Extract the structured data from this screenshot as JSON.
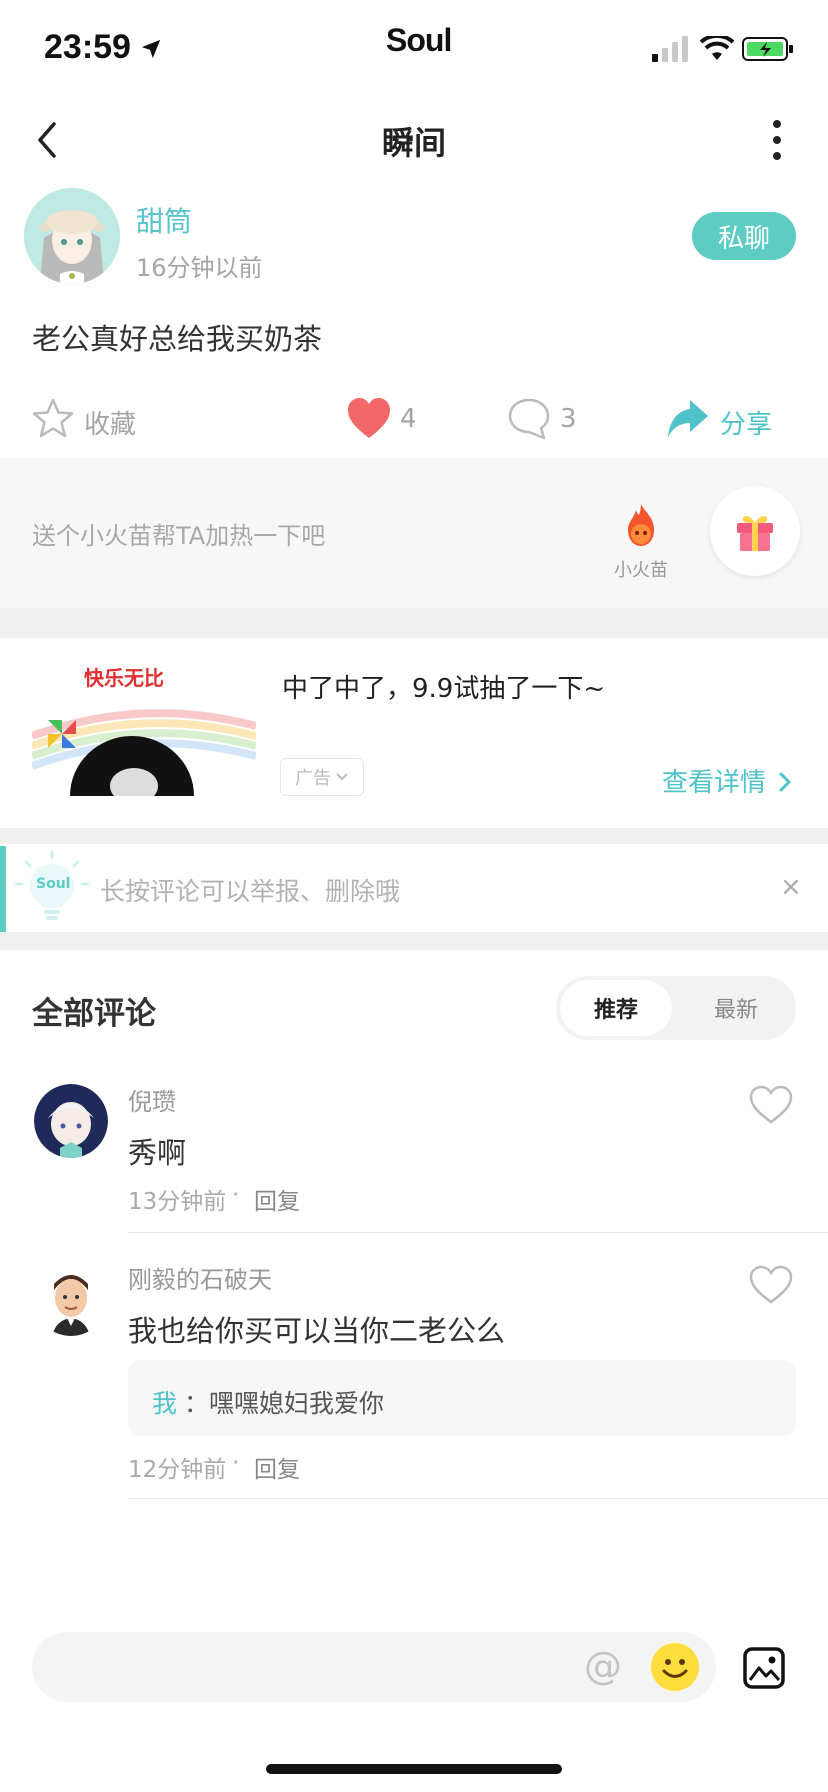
{
  "status_bar": {
    "time": "23:59",
    "carrier": "Soul"
  },
  "nav": {
    "title": "瞬间"
  },
  "post": {
    "author": "甜筒",
    "time": "16分钟以前",
    "dm_label": "私聊",
    "text": "老公真好总给我买奶茶",
    "actions": {
      "favorite_label": "收藏",
      "likes": "4",
      "comments": "3",
      "share_label": "分享"
    }
  },
  "gift": {
    "prompt": "送个小火苗帮TA加热一下吧",
    "fire_label": "小火苗"
  },
  "ad": {
    "image_caption": "快乐无比",
    "title": "中了中了，9.9试抽了一下~",
    "tag": "广告",
    "link": "查看详情"
  },
  "tip": {
    "text": "长按评论可以举报、删除哦",
    "brand": "Soul",
    "close": "×"
  },
  "comments": {
    "title": "全部评论",
    "sort_options": [
      "推荐",
      "最新"
    ],
    "items": [
      {
        "author": "倪瓒",
        "text": "秀啊",
        "time": "13分钟前",
        "reply_label": "回复",
        "separator": "·"
      },
      {
        "author": "刚毅的石破天",
        "text": "我也给你买可以当你二老公么",
        "time": "12分钟前",
        "reply_label": "回复",
        "separator": "·",
        "replies": [
          {
            "author": "我",
            "text": "：嘿嘿媳妇我爱你"
          }
        ]
      }
    ]
  },
  "input": {
    "at_symbol": "@"
  },
  "colors": {
    "accent": "#5dcdc4",
    "like": "#f26767",
    "link": "#4fc3c9"
  }
}
